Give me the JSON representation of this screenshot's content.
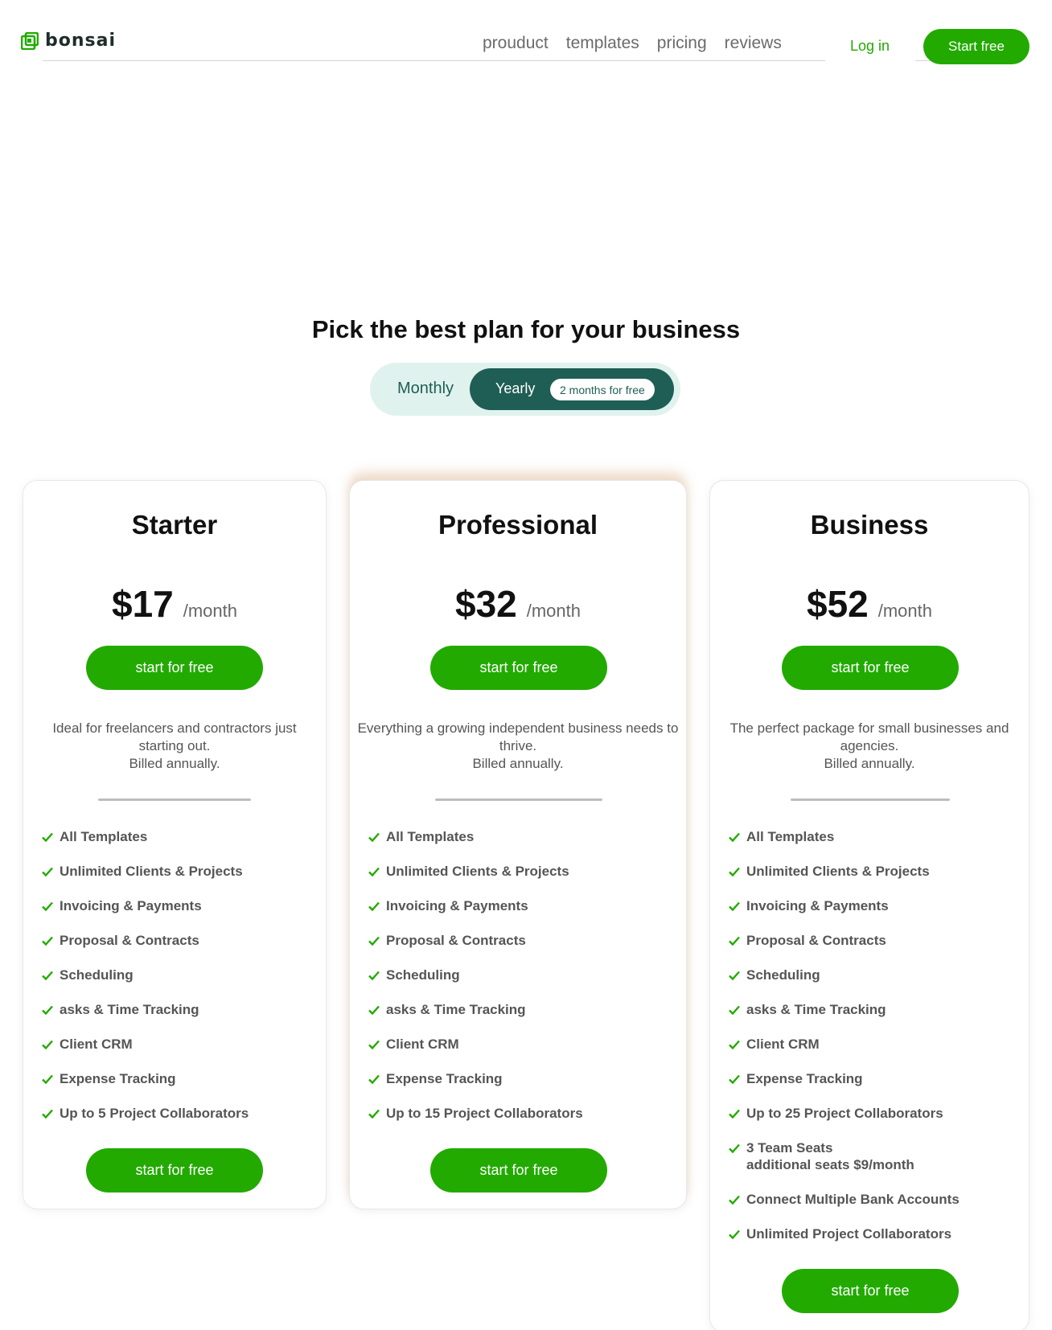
{
  "brand": {
    "name": "bonsai",
    "color": "#22aa00"
  },
  "nav": {
    "items": [
      "prouduct",
      "templates",
      "pricing",
      "reviews"
    ],
    "login": "Log in",
    "cta": "Start free"
  },
  "pricing": {
    "title": "Pick the best plan for your business",
    "toggle": {
      "monthly": "Monthly",
      "yearly": "Yearly",
      "badge": "2 months for free",
      "selected": "Yearly"
    },
    "plans": [
      {
        "name": "Starter",
        "price": "$17",
        "period": "/month",
        "cta": "start for free",
        "description": "Ideal for freelancers and contractors just starting out.",
        "billing": "Billed annually.",
        "features": [
          "All Templates",
          "Unlimited Clients & Projects",
          "Invoicing & Payments",
          "Proposal & Contracts",
          "Scheduling",
          "asks & Time Tracking",
          "Client CRM",
          "Expense Tracking",
          "Up to 5 Project Collaborators"
        ],
        "cta_bottom": "start for free"
      },
      {
        "name": "Professional",
        "price": "$32",
        "period": "/month",
        "cta": "start for free",
        "description": "Everything a growing independent business needs to thrive.",
        "billing": "Billed annually.",
        "features": [
          "All Templates",
          "Unlimited Clients & Projects",
          "Invoicing & Payments",
          "Proposal & Contracts",
          "Scheduling",
          "asks & Time Tracking",
          "Client CRM",
          "Expense Tracking",
          "Up to 15 Project Collaborators"
        ],
        "cta_bottom": "start for free"
      },
      {
        "name": "Business",
        "price": "$52",
        "period": "/month",
        "cta": "start for free",
        "description": "The perfect package for small businesses and agencies.",
        "billing": "Billed annually.",
        "features": [
          "All Templates",
          "Unlimited Clients & Projects",
          "Invoicing & Payments",
          "Proposal & Contracts",
          "Scheduling",
          "asks & Time Tracking",
          "Client CRM",
          "Expense Tracking",
          "Up to 25 Project Collaborators",
          "3 Team Seats",
          "Connect Multiple Bank Accounts",
          "Unlimited Project Collaborators"
        ],
        "feature_notes": {
          "9": "additional seats $9/month"
        },
        "cta_bottom": "start for free"
      }
    ]
  }
}
